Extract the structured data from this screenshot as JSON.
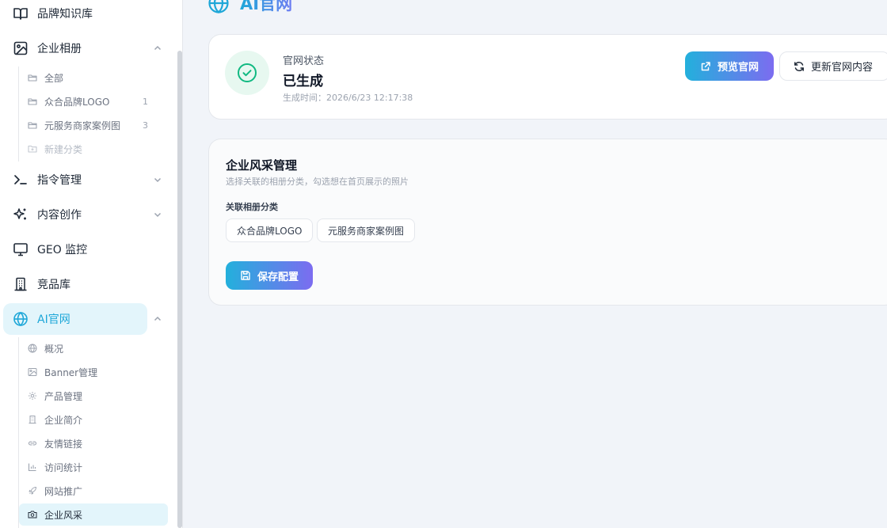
{
  "sidebar": {
    "knowledge_base": "品牌知识库",
    "album": "企业相册",
    "album_items": [
      {
        "label": "全部",
        "count": ""
      },
      {
        "label": "众合品牌LOGO",
        "count": "1"
      },
      {
        "label": "元服务商家案例图",
        "count": "3"
      },
      {
        "label": "新建分类",
        "count": ""
      }
    ],
    "commands": "指令管理",
    "content": "内容创作",
    "geo": "GEO 监控",
    "competitors": "竞品库",
    "ai_site": "AI官网",
    "ai_site_items": [
      {
        "label": "概况",
        "icon": "globe-icon"
      },
      {
        "label": "Banner管理",
        "icon": "image-icon"
      },
      {
        "label": "产品管理",
        "icon": "gear-icon"
      },
      {
        "label": "企业简介",
        "icon": "building-icon"
      },
      {
        "label": "友情链接",
        "icon": "link-icon"
      },
      {
        "label": "访问统计",
        "icon": "bar-chart-icon"
      },
      {
        "label": "网站推广",
        "icon": "rocket-icon"
      },
      {
        "label": "企业风采",
        "icon": "camera-icon"
      }
    ]
  },
  "main": {
    "page_title": "AI官网",
    "status": {
      "label": "官网状态",
      "value": "已生成",
      "time": "生成时间：2026/6/23 12:17:38",
      "preview_button": "预览官网",
      "refresh_button": "更新官网内容"
    },
    "style": {
      "title": "企业风采管理",
      "description": "选择关联的相册分类，勾选想在首页展示的照片",
      "category_label": "关联相册分类",
      "categories": [
        "众合品牌LOGO",
        "元服务商家案例图"
      ],
      "save_button": "保存配置"
    }
  },
  "colors": {
    "accent": "#1ea7d8",
    "accent_gradient_end": "#7c6cf0",
    "success": "#10b981",
    "active_bg": "#e3f5fb"
  }
}
